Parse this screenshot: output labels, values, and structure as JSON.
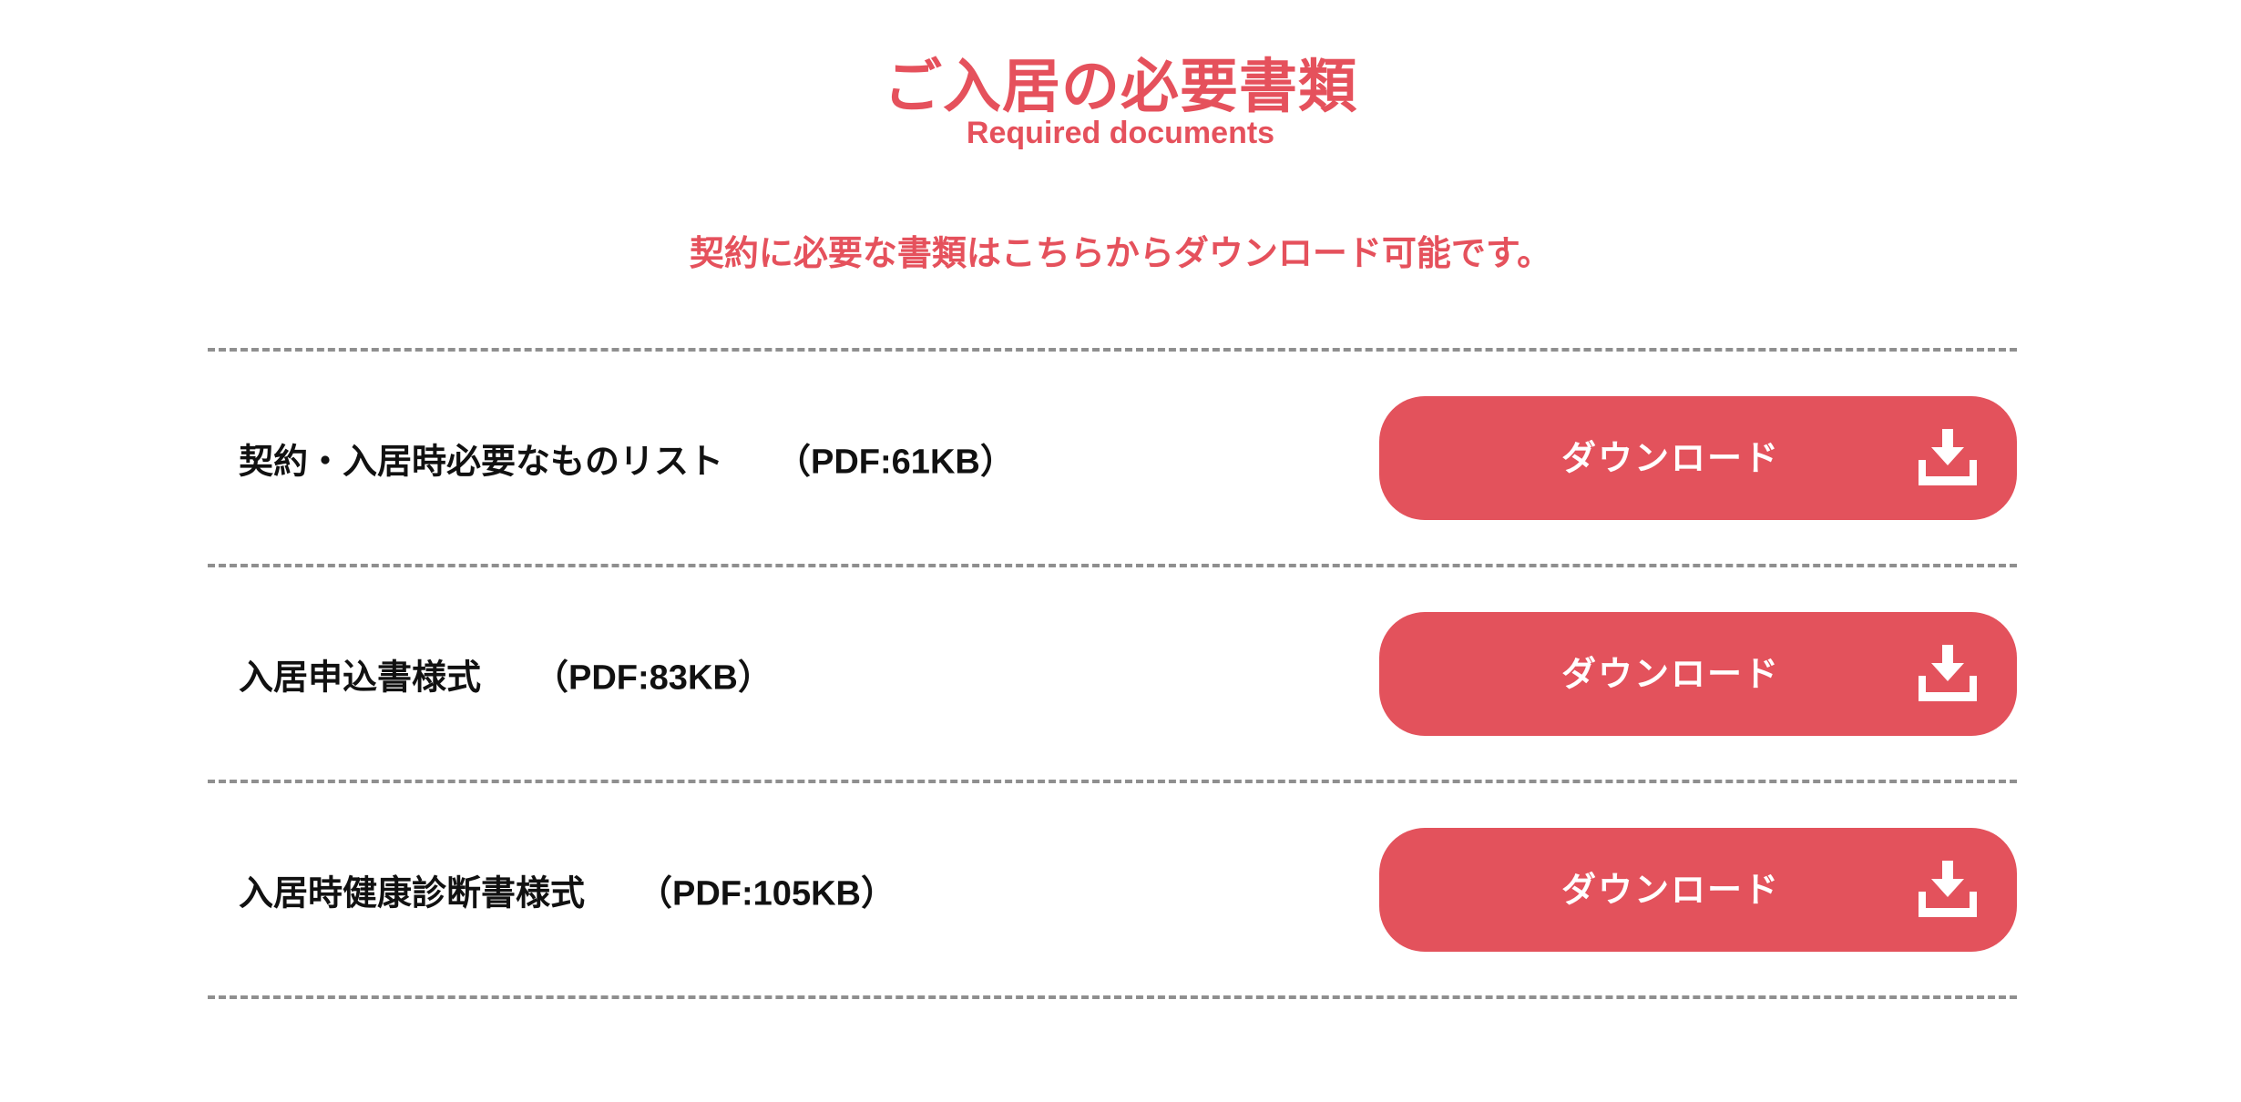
{
  "header": {
    "title_ja": "ご入居の必要書類",
    "title_en": "Required documents"
  },
  "lead_text": "契約に必要な書類はこちらからダウンロード可能です。",
  "theme": {
    "accent": "#e3525c",
    "divider": "#8f8f8f",
    "text": "#111111"
  },
  "documents": [
    {
      "name": "契約・入居時必要なものリスト",
      "size": "（PDF:61KB）",
      "button_label": "ダウンロード",
      "icon": "download-icon"
    },
    {
      "name": "入居申込書様式",
      "size": "（PDF:83KB）",
      "button_label": "ダウンロード",
      "icon": "download-icon"
    },
    {
      "name": "入居時健康診断書様式",
      "size": "（PDF:105KB）",
      "button_label": "ダウンロード",
      "icon": "download-icon"
    }
  ]
}
